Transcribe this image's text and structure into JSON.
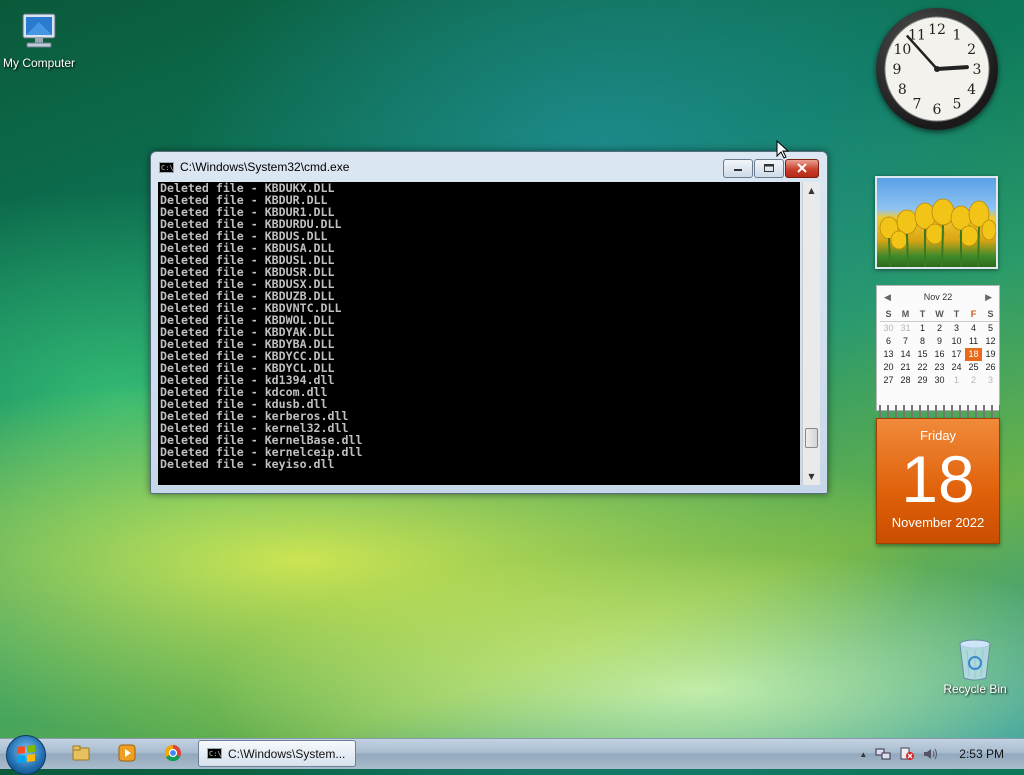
{
  "desktop": {
    "icons": [
      {
        "label": "My Computer",
        "icon": "computer-icon"
      },
      {
        "label": "Recycle Bin",
        "icon": "recycle-bin-icon"
      }
    ]
  },
  "cmd_window": {
    "title": "C:\\Windows\\System32\\cmd.exe",
    "lines": [
      "Deleted file - KBDUKX.DLL",
      "Deleted file - KBDUR.DLL",
      "Deleted file - KBDUR1.DLL",
      "Deleted file - KBDURDU.DLL",
      "Deleted file - KBDUS.DLL",
      "Deleted file - KBDUSA.DLL",
      "Deleted file - KBDUSL.DLL",
      "Deleted file - KBDUSR.DLL",
      "Deleted file - KBDUSX.DLL",
      "Deleted file - KBDUZB.DLL",
      "Deleted file - KBDVNTC.DLL",
      "Deleted file - KBDWOL.DLL",
      "Deleted file - KBDYAK.DLL",
      "Deleted file - KBDYBA.DLL",
      "Deleted file - KBDYCC.DLL",
      "Deleted file - KBDYCL.DLL",
      "Deleted file - kd1394.dll",
      "Deleted file - kdcom.dll",
      "Deleted file - kdusb.dll",
      "Deleted file - kerberos.dll",
      "Deleted file - kernel32.dll",
      "Deleted file - KernelBase.dll",
      "Deleted file - kernelceip.dll",
      "Deleted file - keyiso.dll"
    ],
    "scroll_position": 0.92
  },
  "calendar": {
    "month_label": "Nov 22",
    "day_headers": [
      "S",
      "M",
      "T",
      "W",
      "T",
      "F",
      "S"
    ],
    "weeks": [
      [
        {
          "d": "30",
          "m": true
        },
        {
          "d": "31",
          "m": true
        },
        {
          "d": "1"
        },
        {
          "d": "2"
        },
        {
          "d": "3"
        },
        {
          "d": "4"
        },
        {
          "d": "5"
        }
      ],
      [
        {
          "d": "6"
        },
        {
          "d": "7"
        },
        {
          "d": "8"
        },
        {
          "d": "9"
        },
        {
          "d": "10"
        },
        {
          "d": "11"
        },
        {
          "d": "12"
        }
      ],
      [
        {
          "d": "13"
        },
        {
          "d": "14"
        },
        {
          "d": "15"
        },
        {
          "d": "16"
        },
        {
          "d": "17"
        },
        {
          "d": "18",
          "t": true
        },
        {
          "d": "19"
        }
      ],
      [
        {
          "d": "20"
        },
        {
          "d": "21"
        },
        {
          "d": "22"
        },
        {
          "d": "23"
        },
        {
          "d": "24"
        },
        {
          "d": "25"
        },
        {
          "d": "26"
        }
      ],
      [
        {
          "d": "27"
        },
        {
          "d": "28"
        },
        {
          "d": "29"
        },
        {
          "d": "30"
        },
        {
          "d": "1",
          "m": true
        },
        {
          "d": "2",
          "m": true
        },
        {
          "d": "3",
          "m": true
        }
      ]
    ],
    "big": {
      "weekday": "Friday",
      "day": "18",
      "month_year": "November 2022"
    }
  },
  "clock": {
    "hour": 2,
    "minute": 53,
    "numerals": [
      "12",
      "1",
      "2",
      "3",
      "4",
      "5",
      "6",
      "7",
      "8",
      "9",
      "10",
      "11"
    ]
  },
  "taskbar": {
    "task_label": "C:\\Windows\\System...",
    "time": "2:53 PM",
    "tray_up_arrow": "▲"
  },
  "colors": {
    "accent": "#e86a1a",
    "console_bg": "#000000",
    "console_fg": "#c0c0c0"
  }
}
